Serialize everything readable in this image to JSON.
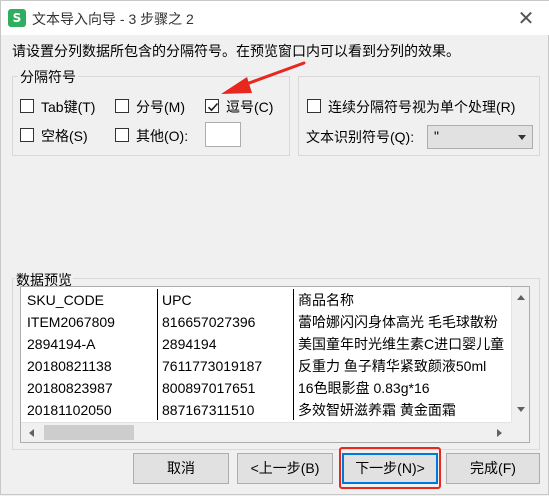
{
  "window": {
    "title": "文本导入向导 - 3 步骤之 2",
    "app_icon_letter": "S",
    "close_glyph": "✕"
  },
  "instruction": "请设置分列数据所包含的分隔符号。在预览窗口内可以看到分列的效果。",
  "delimiters": {
    "group_label": "分隔符号",
    "tab": {
      "label": "Tab键(T)",
      "checked": false
    },
    "semicolon": {
      "label": "分号(M)",
      "checked": false
    },
    "comma": {
      "label": "逗号(C)",
      "checked": true
    },
    "space": {
      "label": "空格(S)",
      "checked": false
    },
    "other": {
      "label": "其他(O):",
      "checked": false,
      "value": ""
    }
  },
  "options": {
    "consecutive": {
      "label": "连续分隔符号视为单个处理(R)",
      "checked": false
    },
    "text_qualifier_label": "文本识别符号(Q):",
    "text_qualifier_value": "\""
  },
  "preview": {
    "label": "数据预览",
    "columns": [
      "SKU_CODE",
      "UPC",
      "商品名称"
    ],
    "rows": [
      [
        "ITEM2067809",
        "816657027396",
        "蕾哈娜闪闪身体高光 毛毛球散粉"
      ],
      [
        "2894194-A",
        "2894194",
        "美国童年时光维生素C进口婴儿童"
      ],
      [
        "20180821138",
        "7611773019187",
        "反重力 鱼子精华紧致颜液50ml"
      ],
      [
        "20180823987",
        "800897017651",
        "16色眼影盘 0.83g*16"
      ],
      [
        "20181102050",
        "887167311510",
        "多效智妍滋养霜 黄金面霜"
      ]
    ]
  },
  "buttons": {
    "cancel": "取消",
    "back": "<上一步(B)",
    "next": "下一步(N)>",
    "finish": "完成(F)"
  },
  "colors": {
    "accent": "#0078d7",
    "annotation_red": "#e8281e",
    "app_icon": "#2fae5f"
  }
}
